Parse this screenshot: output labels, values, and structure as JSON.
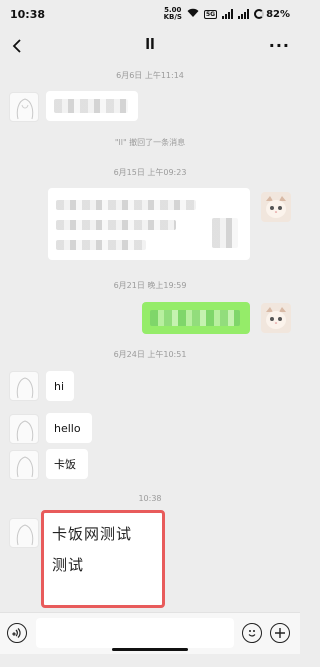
{
  "status": {
    "time": "10:38",
    "net_speed": "5.00",
    "net_unit": "KB/S",
    "badge": "5G",
    "battery": "82%"
  },
  "header": {
    "title": "ll",
    "more": "···"
  },
  "messages": [
    {
      "time": "6月6日 上午11:14"
    },
    {
      "system": "\"ll\" 撤回了一条消息"
    },
    {
      "time": "6月15日 上午09:23"
    },
    {
      "time": "6月21日 晚上19:59"
    },
    {
      "time": "6月24日 上午10:51"
    },
    {
      "text": "hi"
    },
    {
      "text": "hello"
    },
    {
      "text": "卡饭"
    },
    {
      "time": "10:38"
    },
    {
      "text": "卡饭网测试"
    },
    {
      "text": "测试"
    }
  ],
  "icons": {
    "back": "chevron-left-icon",
    "voice": "voice-icon",
    "emoji": "emoji-icon",
    "plus": "plus-icon"
  }
}
